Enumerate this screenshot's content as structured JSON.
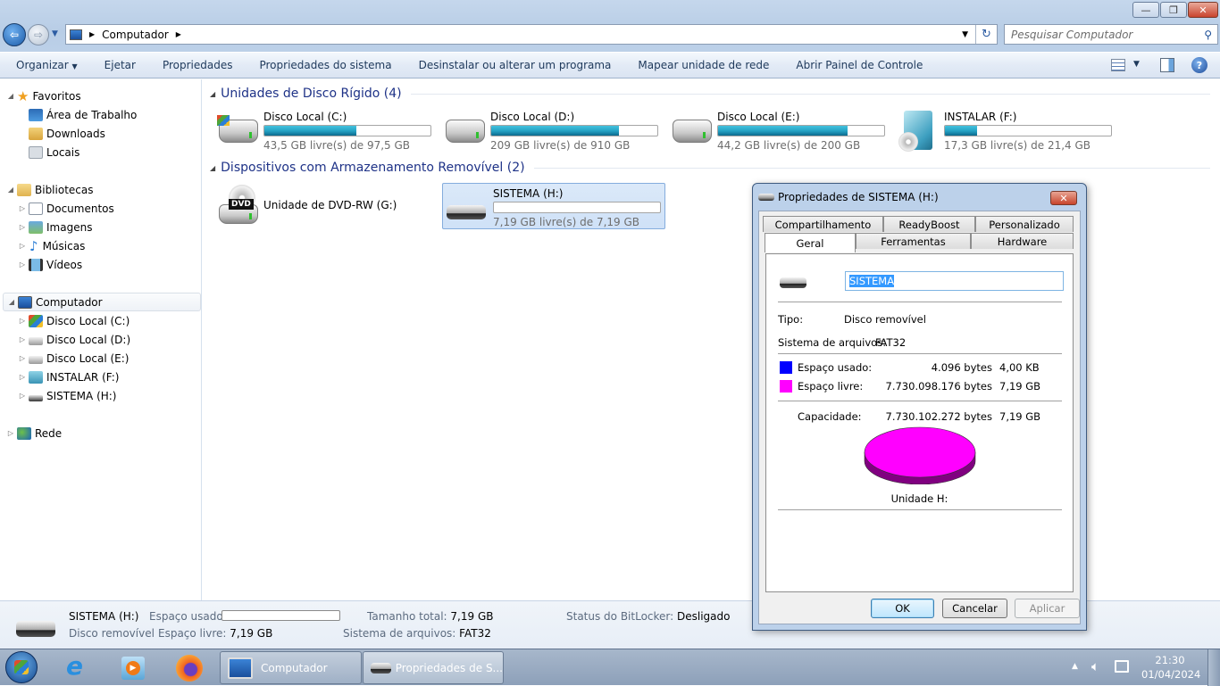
{
  "window": {
    "minimize": "—",
    "maximize": "❐",
    "close": "✕"
  },
  "address": {
    "path": "Computador",
    "search_placeholder": "Pesquisar Computador"
  },
  "toolbar": {
    "items": [
      "Organizar",
      "Ejetar",
      "Propriedades",
      "Propriedades do sistema",
      "Desinstalar ou alterar um programa",
      "Mapear unidade de rede",
      "Abrir Painel de Controle"
    ]
  },
  "sidebar": {
    "favoritos": {
      "label": "Favoritos",
      "items": [
        "Área de Trabalho",
        "Downloads",
        "Locais"
      ]
    },
    "bibliotecas": {
      "label": "Bibliotecas",
      "items": [
        "Documentos",
        "Imagens",
        "Músicas",
        "Vídeos"
      ]
    },
    "computador": {
      "label": "Computador",
      "items": [
        "Disco Local (C:)",
        "Disco Local (D:)",
        "Disco Local (E:)",
        "INSTALAR (F:)",
        "SISTEMA (H:)"
      ]
    },
    "rede": {
      "label": "Rede"
    }
  },
  "main": {
    "hard_disks": {
      "header": "Unidades de Disco Rígido (4)",
      "drives": [
        {
          "name": "Disco Local (C:)",
          "info": "43,5 GB livre(s) de 97,5 GB",
          "used_fraction": 0.554
        },
        {
          "name": "Disco Local (D:)",
          "info": "209 GB livre(s) de 910 GB",
          "used_fraction": 0.77
        },
        {
          "name": "Disco Local (E:)",
          "info": "44,2 GB livre(s) de 200 GB",
          "used_fraction": 0.779
        },
        {
          "name": "INSTALAR (F:)",
          "info": "17,3 GB livre(s) de 21,4 GB",
          "used_fraction": 0.192
        }
      ]
    },
    "removable": {
      "header": "Dispositivos com Armazenamento Removível (2)",
      "dvd": {
        "name": "Unidade de DVD-RW (G:)",
        "badge": "DVD"
      },
      "usb": {
        "name": "SISTEMA (H:)",
        "info": "7,19 GB livre(s) de 7,19 GB",
        "used_fraction": 0.0
      }
    }
  },
  "details": {
    "name": "SISTEMA (H:)",
    "type": "Disco removível",
    "used_label": "Espaço usado:",
    "free_label": "Espaço livre:",
    "free_value": "7,19 GB",
    "total_label": "Tamanho total:",
    "total_value": "7,19 GB",
    "fs_label": "Sistema de arquivos:",
    "fs_value": "FAT32",
    "bitlocker_label": "Status do BitLocker:",
    "bitlocker_value": "Desligado"
  },
  "dialog": {
    "title": "Propriedades de SISTEMA (H:)",
    "tabs_back": [
      "Compartilhamento",
      "ReadyBoost",
      "Personalizado"
    ],
    "tabs_front": [
      "Geral",
      "Ferramentas",
      "Hardware"
    ],
    "active_tab": "Geral",
    "volume_name": "SISTEMA",
    "type_label": "Tipo:",
    "type_value": "Disco removível",
    "fs_label": "Sistema de arquivos:",
    "fs_value": "FAT32",
    "used_label": "Espaço usado:",
    "used_bytes": "4.096 bytes",
    "used_size": "4,00 KB",
    "free_label": "Espaço livre:",
    "free_bytes": "7.730.098.176 bytes",
    "free_size": "7,19 GB",
    "capacity_label": "Capacidade:",
    "capacity_bytes": "7.730.102.272 bytes",
    "capacity_size": "7,19 GB",
    "drive_label": "Unidade H:",
    "colors": {
      "used": "#0000ff",
      "free": "#ff00ff",
      "free_side": "#800080"
    },
    "buttons": {
      "ok": "OK",
      "cancel": "Cancelar",
      "apply": "Aplicar"
    }
  },
  "taskbar": {
    "pinned": [
      "start-button",
      "internet-explorer",
      "media-player",
      "firefox"
    ],
    "programs": [
      "Computador",
      "Propriedades de S..."
    ],
    "time": "21:30",
    "date": "01/04/2024"
  }
}
